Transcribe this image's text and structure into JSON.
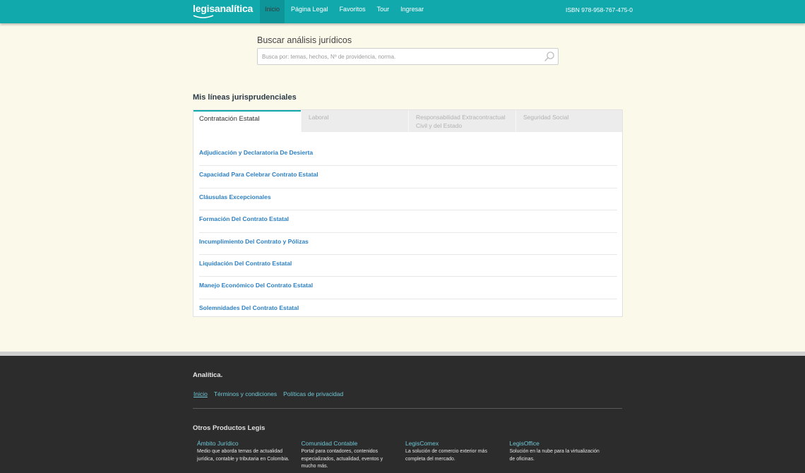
{
  "header": {
    "logo_text": "legisanalítica",
    "nav": [
      {
        "label": "Inicio",
        "active": true
      },
      {
        "label": "Página Legal",
        "active": false
      },
      {
        "label": "Favoritos",
        "active": false
      },
      {
        "label": "Tour",
        "active": false
      },
      {
        "label": "Ingresar",
        "active": false
      }
    ],
    "isbn": "ISBN 978-958-767-475-0"
  },
  "search": {
    "title": "Buscar análisis jurídicos",
    "placeholder": "Busca por: temas, hechos, Nº de providencia, norma.",
    "value": "",
    "icon": "search-icon"
  },
  "lines": {
    "title": "Mis líneas jurisprudenciales",
    "tabs": [
      {
        "label": "Contratación Estatal",
        "active": true
      },
      {
        "label": "Laboral",
        "active": false
      },
      {
        "label": "Responsabilidad Extracontractual Civil y del Estado",
        "active": false
      },
      {
        "label": "Seguridad Social",
        "active": false
      }
    ],
    "items": [
      "Adjudicación y Declaratoria De Desierta",
      "Capacidad Para Celebrar Contrato Estatal",
      "Cláusulas Excepcionales",
      "Formación Del Contrato Estatal",
      "Incumplimiento Del Contrato y Pólizas",
      "Liquidación Del Contrato Estatal",
      "Manejo Económico Del Contrato Estatal",
      "Solemnidades Del Contrato Estatal"
    ]
  },
  "footer": {
    "brand": "Analítica.",
    "links": [
      "Inicio",
      "Términos y condiciones",
      "Políticas de privacidad"
    ],
    "subtitle": "Otros Productos Legis",
    "products": [
      {
        "name": "Ámbito Jurídico",
        "desc": "Medio que aborda temas de actualidad jurídica, contable y tributaria en Colombia."
      },
      {
        "name": "Comunidad Contable",
        "desc": "Portal para contadores, contenidos especializados, actualidad, eventos y mucho más."
      },
      {
        "name": "LegisComex",
        "desc": "La solución de comercio exterior más completa del mercado."
      },
      {
        "name": "LegisOffice",
        "desc": "Solución en la nube para la virtualización de oficinas."
      }
    ]
  },
  "colors": {
    "brand_teal": "#12a9ad",
    "link_blue": "#2c7fc2",
    "footer_bg": "#2c2c2c",
    "page_bg": "#fbf9ea"
  }
}
